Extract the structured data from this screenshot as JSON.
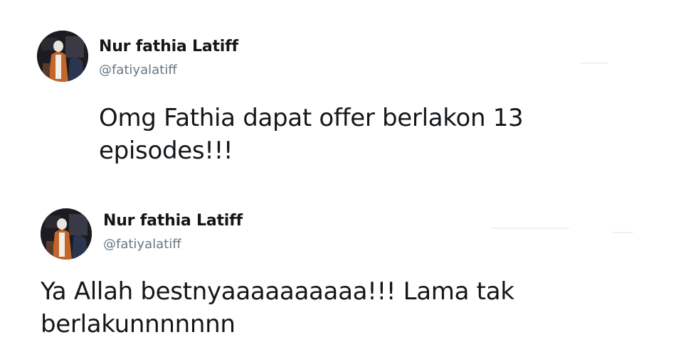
{
  "tweets": [
    {
      "author": {
        "name": "Nur fathia Latiff",
        "handle": "@fatiyalatiff"
      },
      "text": "Omg Fathia dapat offer berlakon 13 episodes!!!"
    },
    {
      "author": {
        "name": "Nur fathia Latiff",
        "handle": "@fatiyalatiff"
      },
      "text": "Ya Allah bestnyaaaaaaaaaa!!! Lama tak berlakunnnnnnn"
    }
  ],
  "colors": {
    "name": "#14171a",
    "handle": "#657786",
    "text": "#14171a",
    "background": "#ffffff"
  }
}
